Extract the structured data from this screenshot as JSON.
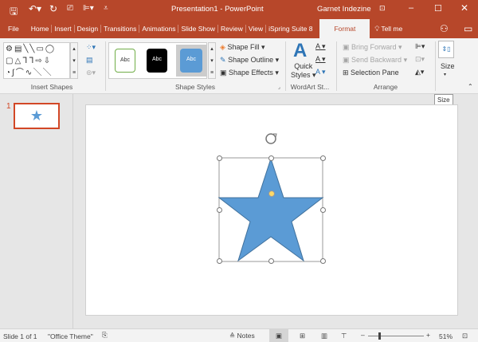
{
  "window": {
    "title": "Presentation1 - PowerPoint",
    "user": "Garnet Indezine"
  },
  "tabs": [
    "File",
    "Home",
    "Insert",
    "Design",
    "Transitions",
    "Animations",
    "Slide Show",
    "Review",
    "View",
    "iSpring Suite 8",
    "Format"
  ],
  "tell_me": "Tell me",
  "ribbon": {
    "insert_shapes": "Insert Shapes",
    "shape_styles": {
      "label": "Shape Styles",
      "swatch": "Abc",
      "fill": "Shape Fill",
      "outline": "Shape Outline",
      "effects": "Shape Effects"
    },
    "wordart": {
      "label": "WordArt St...",
      "quick_styles_1": "Quick",
      "quick_styles_2": "Styles"
    },
    "arrange": {
      "label": "Arrange",
      "bring_forward": "Bring Forward",
      "send_backward": "Send Backward",
      "selection_pane": "Selection Pane"
    },
    "size": {
      "label": "Size",
      "tooltip": "Size"
    }
  },
  "thumbnails": [
    {
      "number": "1"
    }
  ],
  "status": {
    "slide": "Slide 1 of 1",
    "theme": "\"Office Theme\"",
    "notes": "Notes",
    "zoom": "51%",
    "zoom_level": 51
  },
  "colors": {
    "accent": "#B7472A",
    "shape_fill": "#5B9BD5",
    "shape_outline": "#41719C"
  }
}
